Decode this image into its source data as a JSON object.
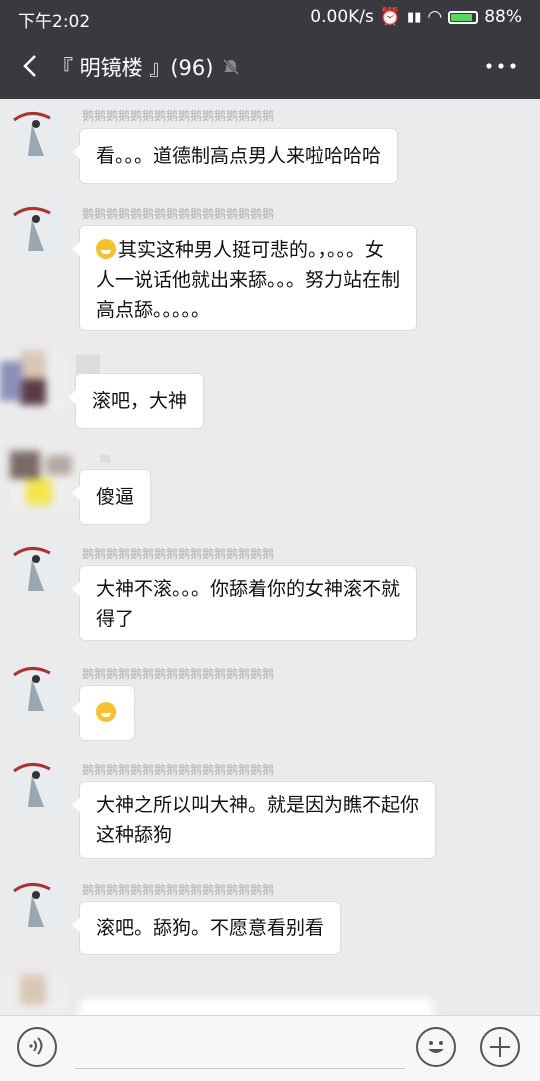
{
  "status": {
    "time": "下午2:02",
    "network_speed": "0.00K/s",
    "battery": "88%",
    "battery_level": 0.88
  },
  "header": {
    "title": "『 明镜楼 』(96)",
    "icons": [
      "back-icon",
      "mute-bell-icon",
      "more-icon"
    ]
  },
  "messages": [
    {
      "nick": "鹅鹅鹅鹅鹅鹅鹅鹅鹅鹅鹅鹅鹅鹅鹅鹅",
      "lines": [
        "看。。。道德制高点男人来啦哈哈哈"
      ],
      "emoji": false
    },
    {
      "nick": "鹅鹅鹅鹅鹅鹅鹅鹅鹅鹅鹅鹅鹅鹅鹅鹅",
      "lines": [
        "其实这种男人挺可悲的。，。。。女",
        "人一说话他就出来舔。。。努力站在制",
        "高点舔。。。。。"
      ],
      "emoji": true
    },
    {
      "nick": "",
      "lines": [
        "滚吧，大神"
      ],
      "emoji": false
    },
    {
      "nick": "",
      "lines": [
        "傻逼"
      ],
      "emoji": false
    },
    {
      "nick": "鹅鹅鹅鹅鹅鹅鹅鹅鹅鹅鹅鹅鹅鹅鹅鹅",
      "lines": [
        "大神不滚。。。你舔着你的女神滚不就",
        "得了"
      ],
      "emoji": false
    },
    {
      "nick": "鹅鹅鹅鹅鹅鹅鹅鹅鹅鹅鹅鹅鹅鹅鹅鹅",
      "lines": [
        ""
      ],
      "emoji": true
    },
    {
      "nick": "鹅鹅鹅鹅鹅鹅鹅鹅鹅鹅鹅鹅鹅鹅鹅鹅",
      "lines": [
        "大神之所以叫大神。就是因为瞧不起你",
        "这种舔狗"
      ],
      "emoji": false
    },
    {
      "nick": "鹅鹅鹅鹅鹅鹅鹅鹅鹅鹅鹅鹅鹅鹅鹅鹅",
      "lines": [
        "滚吧。舔狗。不愿意看别看"
      ],
      "emoji": false
    }
  ],
  "colors": {
    "header_bg": "#393a3f",
    "chat_bg": "#ebebeb",
    "bubble_bg": "#ffffff"
  }
}
